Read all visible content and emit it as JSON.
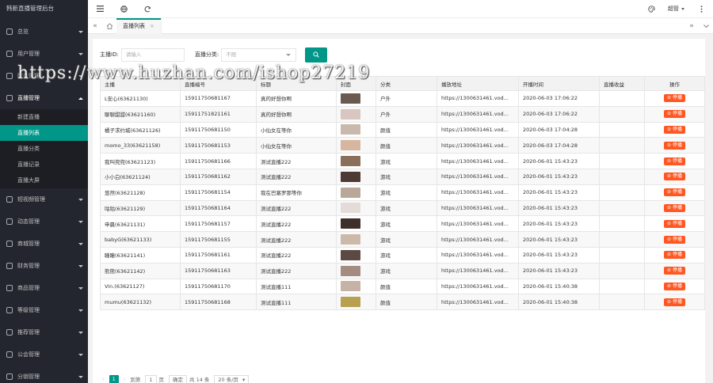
{
  "app": {
    "title": "韩新直播管理后台"
  },
  "sidebar": {
    "items": [
      {
        "label": "总览"
      },
      {
        "label": "用户管理"
      },
      {
        "label": "财务管理"
      },
      {
        "label": "直播管理"
      }
    ],
    "live_sub": [
      {
        "label": "新建直播"
      },
      {
        "label": "直播列表"
      },
      {
        "label": "直播分类"
      },
      {
        "label": "直播记录"
      },
      {
        "label": "直播大屏"
      }
    ],
    "items_after": [
      {
        "label": "短视频管理"
      },
      {
        "label": "动态管理"
      },
      {
        "label": "商城管理"
      },
      {
        "label": "财务管理"
      },
      {
        "label": "商品管理"
      },
      {
        "label": "等级管理"
      },
      {
        "label": "推荐管理"
      },
      {
        "label": "公会管理"
      },
      {
        "label": "分销管理"
      }
    ]
  },
  "header": {
    "user": "超管"
  },
  "tabs": [
    {
      "label": "直播列表"
    }
  ],
  "filters": {
    "anchor_label": "主播ID:",
    "anchor_placeholder": "请输入",
    "category_label": "直播分类:",
    "category_placeholder": "不限"
  },
  "table": {
    "headers": [
      "主播",
      "直播编号",
      "标题",
      "封面",
      "分类",
      "播放地址",
      "开播时间",
      "直播收益",
      "操作"
    ],
    "action_label": "停播",
    "rows": [
      {
        "anchor": "L安心(63621130)",
        "no": "15911750681167",
        "title": "真的好想你啊",
        "cover": "#6b5a4f",
        "cat": "户外",
        "url": "https://1300631461.vod...",
        "time": "2020-06-03 17:06:22",
        "income": ""
      },
      {
        "anchor": "聊聊甜甜(63621160)",
        "no": "15911751821161",
        "title": "真的好想你啊",
        "cover": "#d9c6c0",
        "cat": "户外",
        "url": "https://1300631461.vod...",
        "time": "2020-06-03 17:06:22",
        "income": ""
      },
      {
        "anchor": "橘子求约城(63621126)",
        "no": "15911750681150",
        "title": "小仙女在等你",
        "cover": "#c9b8ae",
        "cat": "颜值",
        "url": "https://1300631461.vod...",
        "time": "2020-06-03 17:04:28",
        "income": ""
      },
      {
        "anchor": "momo_33(63621158)",
        "no": "15911750681153",
        "title": "小仙女在等你",
        "cover": "#d7b69f",
        "cat": "颜值",
        "url": "https://1300631461.vod...",
        "time": "2020-06-03 17:04:28",
        "income": ""
      },
      {
        "anchor": "我叫兜兜(63621123)",
        "no": "15911750681166",
        "title": "测试直播222",
        "cover": "#8a6f5a",
        "cat": "游戏",
        "url": "https://1300631461.vod...",
        "time": "2020-06-01 15:43:23",
        "income": ""
      },
      {
        "anchor": "小小白(63621124)",
        "no": "15911750681162",
        "title": "测试直播222",
        "cover": "#4e3a34",
        "cat": "游戏",
        "url": "https://1300631461.vod...",
        "time": "2020-06-01 15:43:23",
        "income": ""
      },
      {
        "anchor": "悠然(63621128)",
        "no": "15911750681154",
        "title": "我在巴塞罗那等你",
        "cover": "#b9a89a",
        "cat": "游戏",
        "url": "https://1300631461.vod...",
        "time": "2020-06-01 15:43:23",
        "income": ""
      },
      {
        "anchor": "咕咕(63621129)",
        "no": "15911750681164",
        "title": "测试直播222",
        "cover": "#e3dcd8",
        "cat": "游戏",
        "url": "https://1300631461.vod...",
        "time": "2020-06-01 15:43:23",
        "income": ""
      },
      {
        "anchor": "申晨(63621131)",
        "no": "15911750681157",
        "title": "测试直播222",
        "cover": "#3d2f2a",
        "cat": "游戏",
        "url": "https://1300631461.vod...",
        "time": "2020-06-01 15:43:23",
        "income": ""
      },
      {
        "anchor": "babyG(63621133)",
        "no": "15911750681155",
        "title": "测试直播222",
        "cover": "#cdb9a9",
        "cat": "游戏",
        "url": "https://1300631461.vod...",
        "time": "2020-06-01 15:43:23",
        "income": ""
      },
      {
        "anchor": "瞳瞳(63621141)",
        "no": "15911750681161",
        "title": "测试直播222",
        "cover": "#5c4942",
        "cat": "游戏",
        "url": "https://1300631461.vod...",
        "time": "2020-06-01 15:43:23",
        "income": ""
      },
      {
        "anchor": "熊熊(63621142)",
        "no": "15911750681163",
        "title": "测试直播222",
        "cover": "#a48c80",
        "cat": "游戏",
        "url": "https://1300631461.vod...",
        "time": "2020-06-01 15:43:23",
        "income": ""
      },
      {
        "anchor": "Vin.(63621127)",
        "no": "15911750681170",
        "title": "测试直播111",
        "cover": "#c7b3a6",
        "cat": "颜值",
        "url": "https://1300631461.vod...",
        "time": "2020-06-01 15:40:38",
        "income": ""
      },
      {
        "anchor": "mumu(63621132)",
        "no": "15911750681168",
        "title": "测试直播111",
        "cover": "#b7a04f",
        "cat": "颜值",
        "url": "https://1300631461.vod...",
        "time": "2020-06-01 15:40:38",
        "income": ""
      }
    ]
  },
  "pager": {
    "current": "1",
    "goto_label": "到第",
    "page_input": "1",
    "page_unit": "页",
    "confirm": "确定",
    "total": "共 14 条",
    "per_page": "20 条/页"
  },
  "watermark": "https://www.huzhan.com/ishop27219",
  "colors": {
    "accent": "#009688",
    "danger": "#ff5722",
    "sidebar": "#23262e"
  }
}
